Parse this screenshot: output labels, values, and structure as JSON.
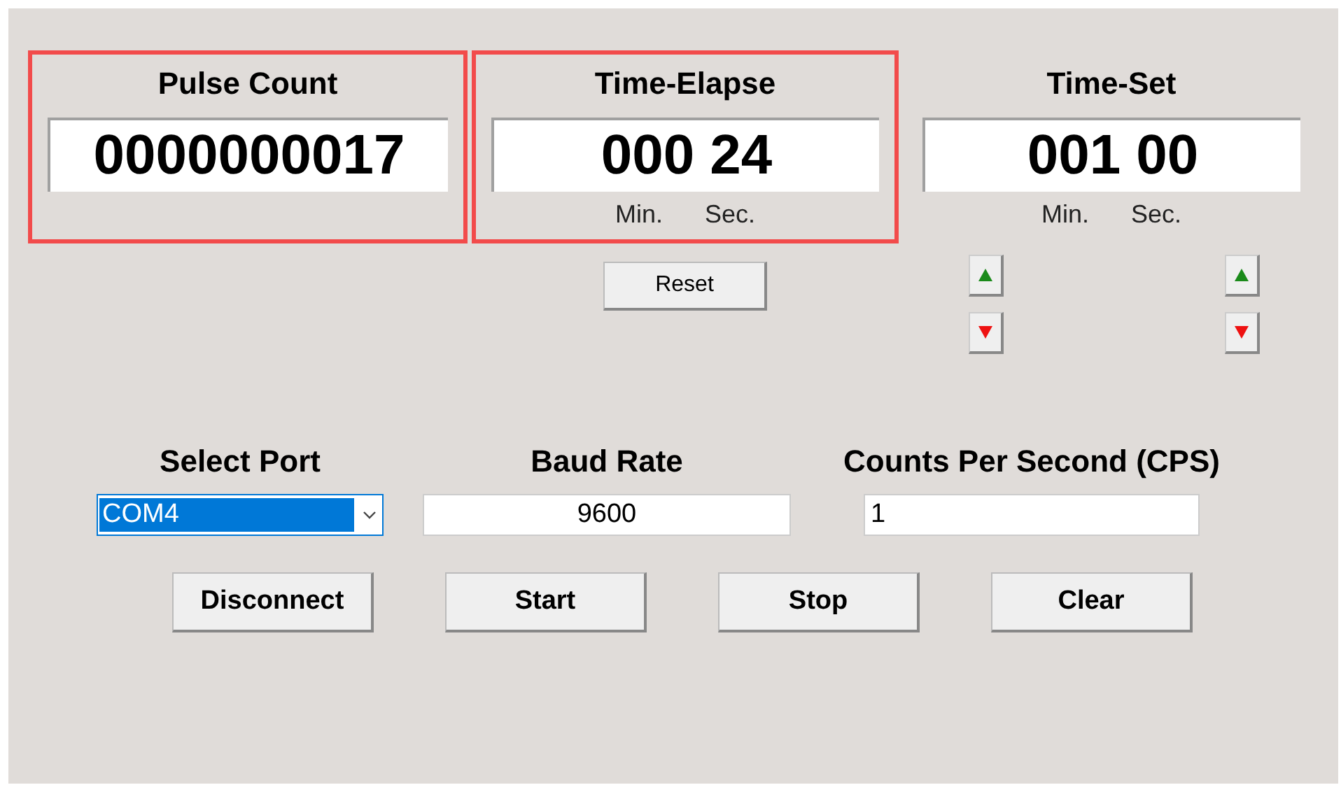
{
  "displays": [
    {
      "title": "Pulse Count",
      "value": "0000000017",
      "highlighted": true
    },
    {
      "title": "Time-Elapse",
      "value": "000 24",
      "units": [
        "Min.",
        "Sec."
      ],
      "highlighted": true
    },
    {
      "title": "Time-Set",
      "value": "001 00",
      "units": [
        "Min.",
        "Sec."
      ],
      "highlighted": false
    }
  ],
  "reset_button": "Reset",
  "adjust_buttons": [
    {
      "kind": "up"
    },
    {
      "kind": "up"
    },
    {
      "kind": "down"
    },
    {
      "kind": "down"
    }
  ],
  "settings": [
    {
      "kind": "dropdown",
      "label": "Select Port",
      "value": "COM4",
      "selected": true
    },
    {
      "kind": "centered",
      "label": "Baud Rate",
      "value": "9600"
    },
    {
      "kind": "text",
      "label": "Counts Per Second (CPS)",
      "value": "1"
    }
  ],
  "buttons": [
    "Disconnect",
    "Start",
    "Stop",
    "Clear"
  ]
}
